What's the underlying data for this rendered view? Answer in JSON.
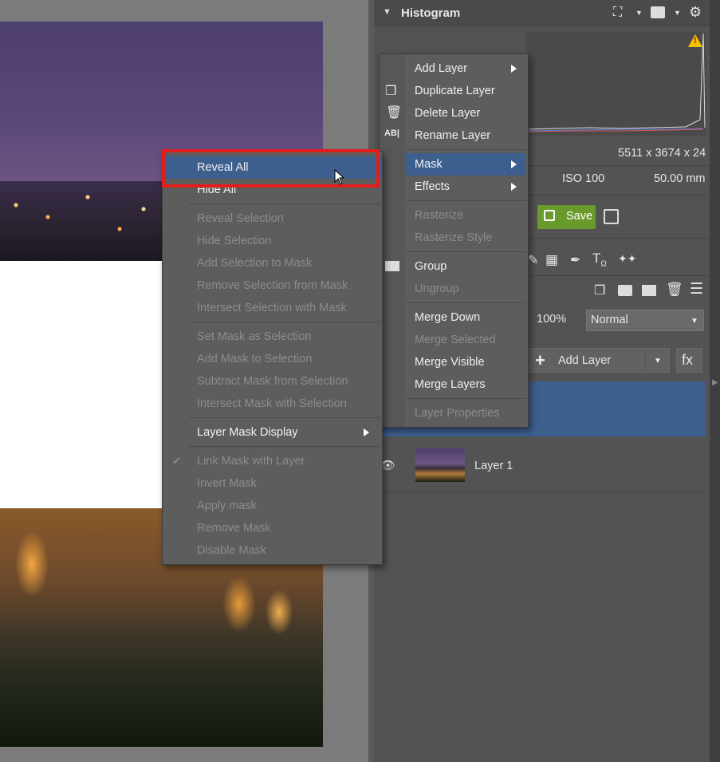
{
  "histogram_panel": {
    "title": "Histogram",
    "dimensions": "5511 x 3674 x 24",
    "iso": "ISO 100",
    "focal_length": "50.00 mm",
    "save_label": "Save"
  },
  "layers_panel": {
    "opacity": "100%",
    "blend_mode": "Normal",
    "add_layer_label": "Add Layer",
    "fx_label": "fx",
    "layer_name": "Layer 1"
  },
  "layer_menu": {
    "items": [
      {
        "label": "Add Layer",
        "enabled": true,
        "submenu": true
      },
      {
        "label": "Duplicate Layer",
        "enabled": true,
        "submenu": false
      },
      {
        "label": "Delete Layer",
        "enabled": true,
        "submenu": false
      },
      {
        "label": "Rename Layer",
        "enabled": true,
        "submenu": false
      },
      {
        "label": "Mask",
        "enabled": true,
        "submenu": true,
        "highlighted": true
      },
      {
        "label": "Effects",
        "enabled": true,
        "submenu": true
      },
      {
        "label": "Rasterize",
        "enabled": false
      },
      {
        "label": "Rasterize Style",
        "enabled": false
      },
      {
        "label": "Group",
        "enabled": true
      },
      {
        "label": "Ungroup",
        "enabled": false
      },
      {
        "label": "Merge Down",
        "enabled": true
      },
      {
        "label": "Merge Selected",
        "enabled": false
      },
      {
        "label": "Merge Visible",
        "enabled": true
      },
      {
        "label": "Merge Layers",
        "enabled": true
      },
      {
        "label": "Layer Properties",
        "enabled": false
      }
    ]
  },
  "mask_menu": {
    "items": [
      {
        "label": "Reveal All",
        "enabled": true,
        "highlighted": true
      },
      {
        "label": "Hide All",
        "enabled": true
      },
      {
        "label": "Reveal Selection",
        "enabled": false
      },
      {
        "label": "Hide Selection",
        "enabled": false
      },
      {
        "label": "Add Selection to Mask",
        "enabled": false
      },
      {
        "label": "Remove Selection from Mask",
        "enabled": false
      },
      {
        "label": "Intersect Selection with Mask",
        "enabled": false
      },
      {
        "label": "Set Mask as Selection",
        "enabled": false
      },
      {
        "label": "Add Mask to Selection",
        "enabled": false
      },
      {
        "label": "Subtract Mask from Selection",
        "enabled": false
      },
      {
        "label": "Intersect Mask with Selection",
        "enabled": false
      },
      {
        "label": "Layer Mask Display",
        "enabled": true,
        "submenu": true
      },
      {
        "label": "Link Mask with Layer",
        "enabled": false,
        "checked": true
      },
      {
        "label": "Invert Mask",
        "enabled": false
      },
      {
        "label": "Apply mask",
        "enabled": false
      },
      {
        "label": "Remove Mask",
        "enabled": false
      },
      {
        "label": "Disable Mask",
        "enabled": false
      }
    ]
  },
  "colors": {
    "highlight": "#3d5f8e",
    "annotation": "#e41c1c",
    "save_button": "#6a9a2b",
    "warning": "#f2c200"
  }
}
